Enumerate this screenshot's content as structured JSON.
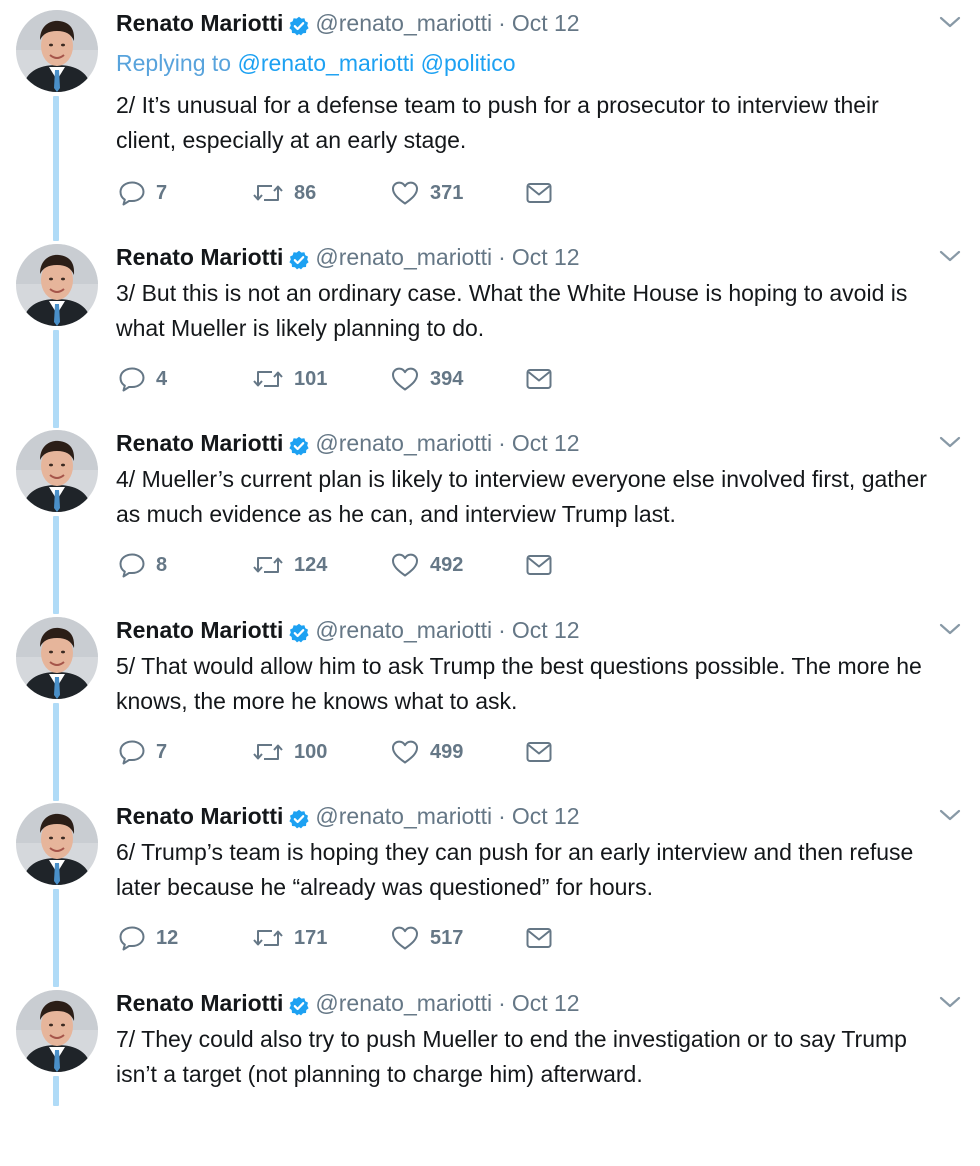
{
  "tweets": [
    {
      "name": "Renato Mariotti",
      "handle": "@renato_mariotti",
      "date": "Oct 12",
      "replying_label": "Replying to",
      "replying_to": "@renato_mariotti @politico",
      "lines": [
        "2/ It’s unusual for a defense team to push for a prosecutor to interview their",
        "client, especially at an early stage."
      ],
      "replies": "7",
      "retweets": "86",
      "likes": "371"
    },
    {
      "name": "Renato Mariotti",
      "handle": "@renato_mariotti",
      "date": "Oct 12",
      "lines": [
        "3/ But this is not an ordinary case.  What the White House is hoping to avoid is",
        "what Mueller is likely planning to do."
      ],
      "replies": "4",
      "retweets": "101",
      "likes": "394"
    },
    {
      "name": "Renato Mariotti",
      "handle": "@renato_mariotti",
      "date": "Oct 12",
      "lines": [
        "4/ Mueller’s current plan is likely to interview everyone else involved first, gather",
        "as much evidence as he can, and interview Trump last."
      ],
      "replies": "8",
      "retweets": "124",
      "likes": "492"
    },
    {
      "name": "Renato Mariotti",
      "handle": "@renato_mariotti",
      "date": "Oct 12",
      "lines": [
        "5/ That would allow him to ask Trump the best questions possible. The more he",
        "knows, the more he knows what to ask."
      ],
      "replies": "7",
      "retweets": "100",
      "likes": "499"
    },
    {
      "name": "Renato Mariotti",
      "handle": "@renato_mariotti",
      "date": "Oct 12",
      "lines": [
        "6/ Trump’s team is hoping they can push for an early interview and then refuse",
        "later because he “already was questioned” for hours."
      ],
      "replies": "12",
      "retweets": "171",
      "likes": "517"
    },
    {
      "name": "Renato Mariotti",
      "handle": "@renato_mariotti",
      "date": "Oct 12",
      "lines": [
        "7/ They could also try to push Mueller to end the investigation or to say Trump",
        "isn’t a target (not planning to charge him) afterward."
      ]
    }
  ],
  "separator": "·",
  "icons": {
    "reply": "reply-icon",
    "retweet": "retweet-icon",
    "like": "heart-icon",
    "message": "envelope-icon",
    "verified": "verified-badge-icon",
    "caret": "chevron-down-icon"
  },
  "colors": {
    "link": "#1da1f2",
    "thread_line": "#b0dbf7",
    "muted": "#657786",
    "text": "#14171a",
    "verified": "#1da1f2"
  }
}
